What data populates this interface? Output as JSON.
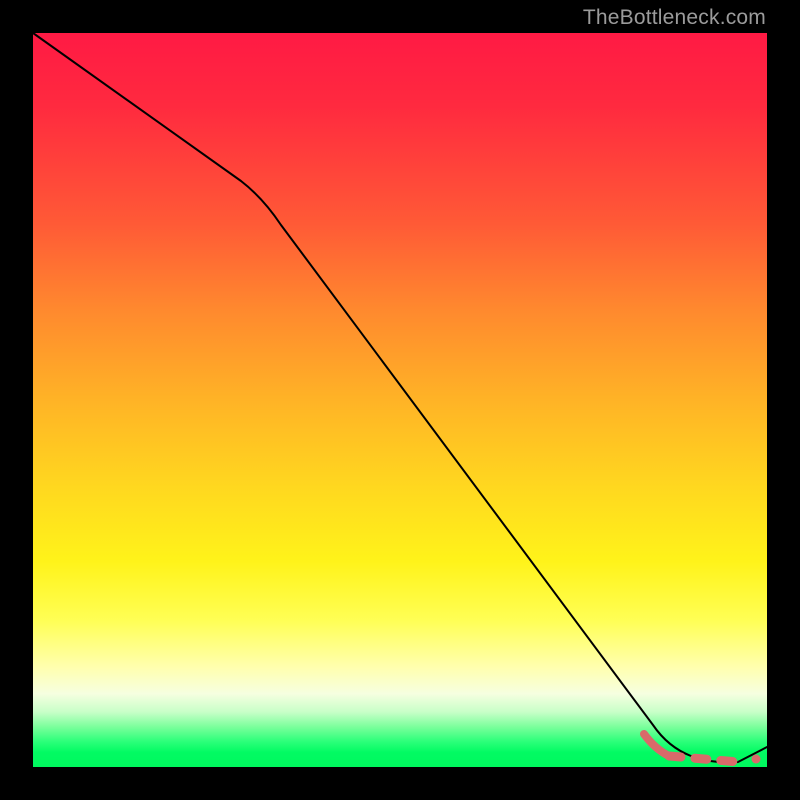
{
  "watermark": "TheBottleneck.com",
  "chart_data": {
    "type": "line",
    "title": "",
    "xlabel": "",
    "ylabel": "",
    "xlim": [
      0,
      100
    ],
    "ylim": [
      0,
      100
    ],
    "grid": false,
    "series": [
      {
        "name": "bottleneck-curve",
        "x": [
          0,
          25,
          30,
          40,
          50,
          60,
          70,
          80,
          85,
          88,
          90,
          92,
          94,
          96,
          98,
          100
        ],
        "y": [
          100,
          80,
          75,
          60,
          46,
          32,
          18,
          6,
          2,
          0.5,
          0,
          0,
          0,
          0,
          1,
          5
        ],
        "style": "solid-black"
      },
      {
        "name": "optimal-range-marker",
        "x": [
          84,
          95
        ],
        "y": [
          0.5,
          0
        ],
        "style": "dashed-salmon"
      }
    ],
    "annotations": []
  },
  "colors": {
    "gradient_top": "#ff1a44",
    "gradient_mid": "#fff31a",
    "gradient_bottom": "#00f85e",
    "curve": "#000000",
    "marker": "#d86a6a",
    "background": "#000000",
    "watermark": "#9b9b9b"
  }
}
